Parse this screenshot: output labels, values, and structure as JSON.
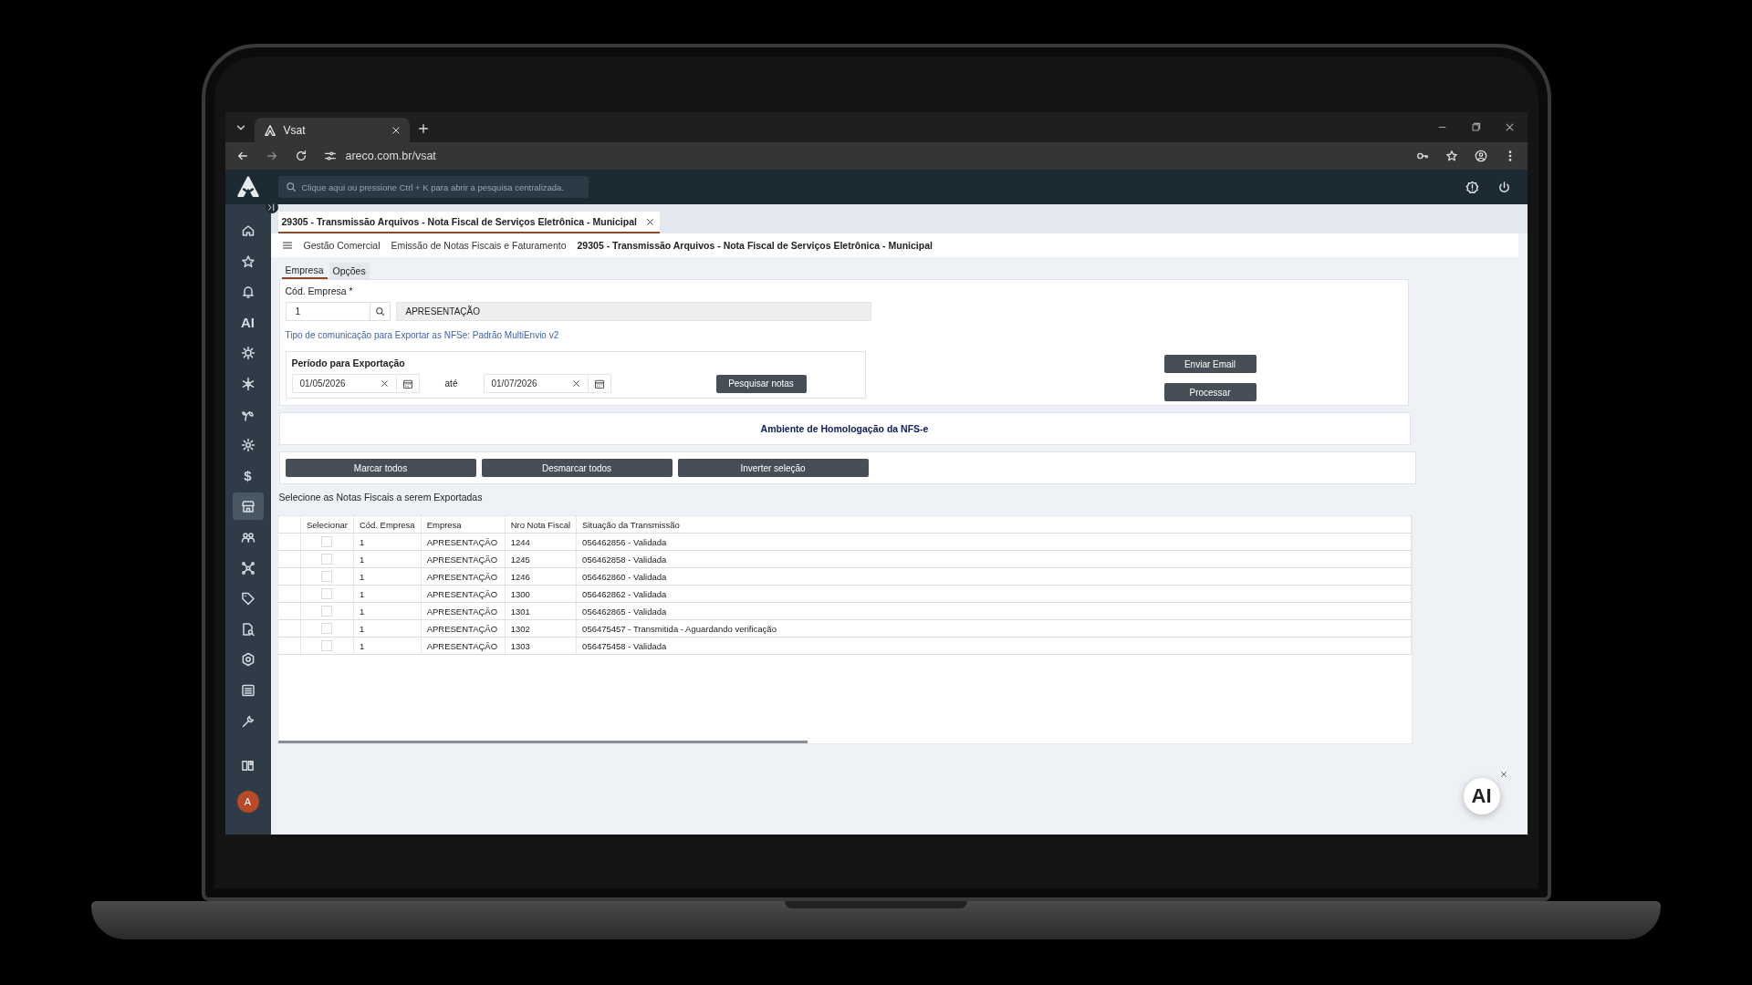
{
  "browser": {
    "tab_title": "Vsat",
    "url": "areco.com.br/vsat"
  },
  "app_header": {
    "search_placeholder": "Clique aqui ou pressione Ctrl + K para abrir a pesquisa centralizada."
  },
  "sidebar": {
    "items": [
      {
        "kind": "icon",
        "selected": false
      },
      {
        "kind": "icon",
        "selected": false
      },
      {
        "kind": "icon",
        "selected": false
      },
      {
        "kind": "text",
        "label": "AI",
        "selected": false
      },
      {
        "kind": "icon",
        "selected": false
      },
      {
        "kind": "icon",
        "selected": false
      },
      {
        "kind": "icon",
        "selected": false
      },
      {
        "kind": "icon",
        "selected": false
      },
      {
        "kind": "text",
        "label": "$",
        "selected": false
      },
      {
        "kind": "icon",
        "selected": true
      },
      {
        "kind": "icon",
        "selected": false
      },
      {
        "kind": "icon",
        "selected": false
      },
      {
        "kind": "icon",
        "selected": false
      },
      {
        "kind": "icon",
        "selected": false
      },
      {
        "kind": "icon",
        "selected": false
      },
      {
        "kind": "icon",
        "selected": false
      },
      {
        "kind": "icon",
        "selected": false
      }
    ],
    "user_initial": "A"
  },
  "document_tab": {
    "title": "29305 - Transmissão Arquivos - Nota Fiscal de Serviços Eletrônica - Municipal"
  },
  "breadcrumb": [
    "Gestão Comercial",
    "Emissão de Notas Fiscais e Faturamento",
    "29305 - Transmissão Arquivos - Nota Fiscal de Serviços Eletrônica - Municipal"
  ],
  "form_tabs": [
    {
      "label": "Empresa",
      "selected": true
    },
    {
      "label": "Opções",
      "selected": false
    }
  ],
  "company": {
    "label": "Cód. Empresa *",
    "code": "1",
    "name": "APRESENTAÇÃO"
  },
  "communication_note": "Tipo de comunicação para Exportar as NFSe: Padrão MultiEnvio v2",
  "period": {
    "title": "Período para Exportação",
    "from": "01/05/2026",
    "separator": "até",
    "to": "01/07/2026",
    "search_button": "Pesquisar notas"
  },
  "side_buttons": [
    "Enviar Email",
    "Processar"
  ],
  "environment_banner": "Ambiente de Homologação da NFS-e",
  "selection_buttons": [
    "Marcar todos",
    "Desmarcar todos",
    "Inverter seleção"
  ],
  "table": {
    "caption": "Selecione as Notas Fiscais a serem Exportadas",
    "select_column": "Selecionar",
    "columns": [
      "Cód. Empresa",
      "Empresa",
      "Nro Nota Fiscal",
      "Situação da Transmissão"
    ],
    "rows": [
      {
        "checked": false,
        "cells": [
          "1",
          "APRESENTAÇÃO",
          "1244",
          "056462856 - Validada"
        ]
      },
      {
        "checked": false,
        "cells": [
          "1",
          "APRESENTAÇÃO",
          "1245",
          "056462858 - Validada"
        ]
      },
      {
        "checked": false,
        "cells": [
          "1",
          "APRESENTAÇÃO",
          "1246",
          "056462860 - Validada"
        ]
      },
      {
        "checked": false,
        "cells": [
          "1",
          "APRESENTAÇÃO",
          "1300",
          "056462862 - Validada"
        ]
      },
      {
        "checked": false,
        "cells": [
          "1",
          "APRESENTAÇÃO",
          "1301",
          "056462865 - Validada"
        ]
      },
      {
        "checked": false,
        "cells": [
          "1",
          "APRESENTAÇÃO",
          "1302",
          "056475457 - Transmitida - Aguardando verificação"
        ]
      },
      {
        "checked": false,
        "cells": [
          "1",
          "APRESENTAÇÃO",
          "1303",
          "056475458 - Validada"
        ]
      }
    ]
  },
  "assistant_button": {
    "label": "AI"
  }
}
